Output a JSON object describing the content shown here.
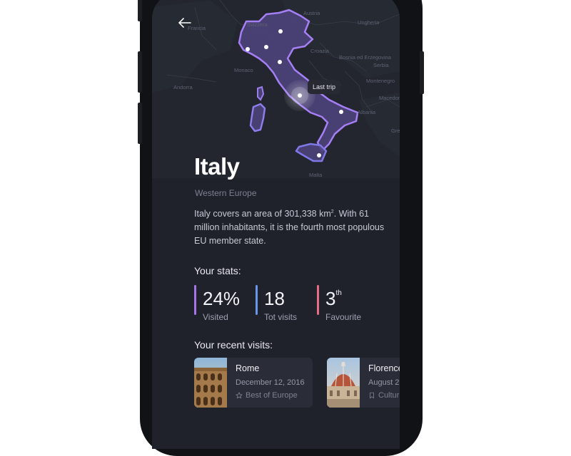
{
  "map": {
    "labels": [
      "Francia",
      "Svizzera",
      "Austria",
      "Ungheria",
      "Croazia",
      "Bosnia ed Erzegovina",
      "Serbia",
      "Monaco",
      "Andorra",
      "Montenegro",
      "Macedonia (FYROM)",
      "Albania",
      "Gre",
      "Malta"
    ],
    "last_trip_label": "Last trip",
    "accent_color": "#8f6cf0"
  },
  "header": {
    "back_icon": "arrow-left-icon"
  },
  "country": {
    "name": "Italy",
    "region": "Western Europe",
    "description_pre": "Italy covers an area of 301,338 km",
    "description_sup": "2",
    "description_post": ". With 61 million inhabitants, it is the fourth most populous EU member state."
  },
  "stats": {
    "title": "Your stats:",
    "items": [
      {
        "value": "24%",
        "sup": "",
        "label": "Visited",
        "color": "#a575e8"
      },
      {
        "value": "18",
        "sup": "",
        "label": "Tot visits",
        "color": "#6a95ee"
      },
      {
        "value": "3",
        "sup": "th",
        "label": "Favourite",
        "color": "#e86c84"
      }
    ]
  },
  "recent": {
    "title": "Your recent visits:",
    "cards": [
      {
        "title": "Rome",
        "date": "December 12, 2016",
        "tag": "Best of Europe",
        "tag_icon": "star-icon"
      },
      {
        "title": "Florence",
        "date": "August 2",
        "tag": "Cultur",
        "tag_icon": "bookmark-icon"
      }
    ]
  }
}
